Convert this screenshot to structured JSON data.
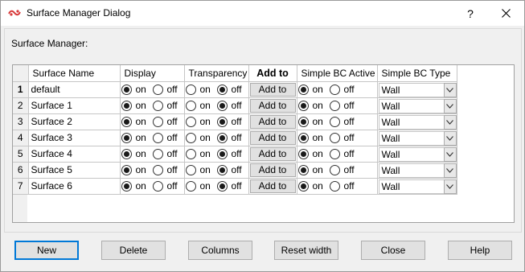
{
  "window": {
    "title": "Surface Manager Dialog",
    "help_label": "?",
    "close_icon": "close-icon"
  },
  "section": {
    "label": "Surface Manager:"
  },
  "grid": {
    "columns": [
      "Surface Name",
      "Display",
      "Transparency",
      "Add to",
      "Simple BC Active",
      "Simple BC Type"
    ],
    "on_label": "on",
    "off_label": "off",
    "add_button_label": "Add to",
    "rows": [
      {
        "num": "1",
        "name": "default",
        "display": "on",
        "transparency": "off",
        "bc_active": "on",
        "bc_type": "Wall"
      },
      {
        "num": "2",
        "name": "Surface 1",
        "display": "on",
        "transparency": "off",
        "bc_active": "on",
        "bc_type": "Wall"
      },
      {
        "num": "3",
        "name": "Surface 2",
        "display": "on",
        "transparency": "off",
        "bc_active": "on",
        "bc_type": "Wall"
      },
      {
        "num": "4",
        "name": "Surface 3",
        "display": "on",
        "transparency": "off",
        "bc_active": "on",
        "bc_type": "Wall"
      },
      {
        "num": "5",
        "name": "Surface 4",
        "display": "on",
        "transparency": "off",
        "bc_active": "on",
        "bc_type": "Wall"
      },
      {
        "num": "6",
        "name": "Surface 5",
        "display": "on",
        "transparency": "off",
        "bc_active": "on",
        "bc_type": "Wall"
      },
      {
        "num": "7",
        "name": "Surface 6",
        "display": "on",
        "transparency": "off",
        "bc_active": "on",
        "bc_type": "Wall"
      }
    ]
  },
  "buttons": {
    "new": "New",
    "delete": "Delete",
    "columns": "Columns",
    "reset_width": "Reset width",
    "close": "Close",
    "help": "Help"
  },
  "colors": {
    "default_button_border": "#0078d7",
    "dialog_bg": "#f0f0f0",
    "grid_line": "#c6c6c6"
  }
}
